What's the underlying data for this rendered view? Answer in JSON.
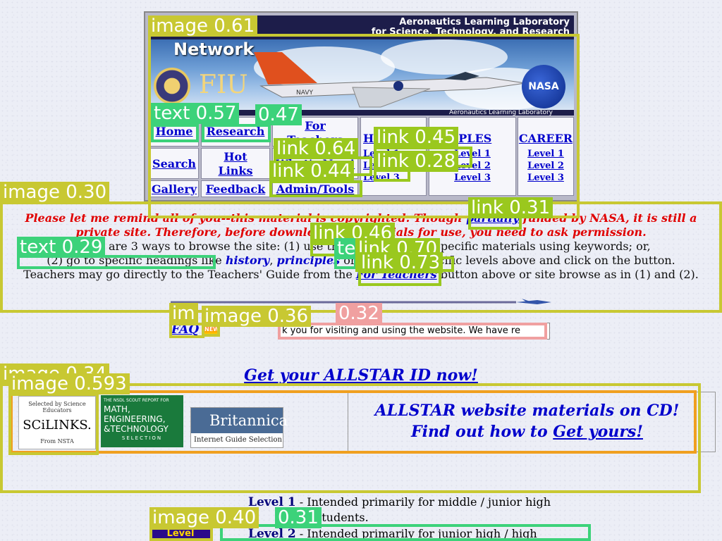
{
  "banner": {
    "title_line1": "Aeronautics Learning Laboratory",
    "title_line2": "for Science, Technology, and Research",
    "network_label": "Network",
    "fiu_label": "FIU",
    "nasa_label": "NASA",
    "plane_label": "NAVY",
    "bottom_caption": "Aeronautics Learning Laboratory"
  },
  "nav": {
    "home": "Home",
    "research": "Research",
    "for_teachers_line1": "For",
    "for_teachers_line2": "Teachers",
    "history_partial": "H",
    "principles_partial": "IPLES",
    "career": "CAREER",
    "search": "Search",
    "hot_links_line1": "Hot",
    "hot_links_line2": "Links",
    "whats_new": "What's New!",
    "gallery": "Gallery",
    "feedback": "Feedback",
    "admin_tools": "Admin/Tools",
    "level1": "Level 1",
    "level2": "Level 2",
    "level3": "Level 3"
  },
  "notice": {
    "red_line1_a": "Please let me remind all of you--this material is copyrighted. Though ",
    "red_partially": "partially",
    "red_line1_b": " funded by NASA, it is still a",
    "red_line2": "private site. Therefore, before downloading materials for use, you need to ask permission.",
    "line3_a": "There are 3 ways to browse the site: (1) use the ",
    "search_link": "search",
    "line3_b": " to find specific materials using keywords; or,",
    "line4_a": "(2) go to specific headings like ",
    "history": "history",
    "principles": "principles",
    "line4_b": " or select the specific levels above and click on the button.",
    "line5_a": "Teachers may go directly to the Teachers' Guide from the ",
    "for_teachers_link": "For Teachers",
    "line5_b": " button above or site browse as in (1) and (2)."
  },
  "faq": "FAQ",
  "new_badge": "NEW",
  "marquee_text": "k you for visiting and using the website.  We have re",
  "allstar_id": "Get your ALLSTAR ID now!",
  "promos": {
    "scilinks_top": "Selected by Science Educators",
    "scilinks_name": "SCiLINKS.",
    "scilinks_bottom": "From NSTA",
    "nsdl_top": "THE NSDL SCOUT REPORT FOR",
    "nsdl_line1": "MATH,",
    "nsdl_line2": "ENGINEERING,",
    "nsdl_line3": "&TECHNOLOGY",
    "nsdl_bottom": "SELECTION",
    "brit_name": "Britannica",
    "brit_sub": "Internet Guide Selection",
    "cd_line1": "ALLSTAR website materials on CD!",
    "cd_line2_a": "Find out how to ",
    "cd_line2_link": "Get yours!"
  },
  "levels": {
    "l1_name": "Level 1",
    "l1_text": " - Intended primarily for middle / junior high",
    "l1_cont": "students.",
    "l2_name": "Level 2",
    "l2_text": " - Intended primarily for junior high / high"
  },
  "bottom_image_label": "Level",
  "detections": [
    {
      "label": "image 0.61",
      "color": "#c8c832"
    },
    {
      "label": "text 0.57",
      "color": "#3cd27a"
    },
    {
      "label": "0.47",
      "color": "#3cd27a"
    },
    {
      "label": "link 0.45",
      "color": "#9ac81e"
    },
    {
      "label": "link 0.64",
      "color": "#9ac81e"
    },
    {
      "label": "link 0.28",
      "color": "#9ac81e"
    },
    {
      "label": "link 0.44",
      "color": "#9ac81e"
    },
    {
      "label": "image 0.30",
      "color": "#c8c832"
    },
    {
      "label": "link 0.31",
      "color": "#9ac81e"
    },
    {
      "label": "link 0.46",
      "color": "#9ac81e"
    },
    {
      "label": "text 0.29",
      "color": "#3cd27a"
    },
    {
      "label": "te",
      "color": "#3cd27a"
    },
    {
      "label": "link 0.70",
      "color": "#9ac81e"
    },
    {
      "label": "link 0.73",
      "color": "#9ac81e"
    },
    {
      "label": "im",
      "color": "#c8c832"
    },
    {
      "label": "image 0.36",
      "color": "#c8c832"
    },
    {
      "label": "0.32",
      "color": "#f0a0a0"
    },
    {
      "label": "image 0.34",
      "color": "#c8c832"
    },
    {
      "label": "image 0.593",
      "color": "#c8c832"
    },
    {
      "label": "image 0.40",
      "color": "#c8c832"
    },
    {
      "label": "0.31",
      "color": "#3cd27a"
    }
  ]
}
